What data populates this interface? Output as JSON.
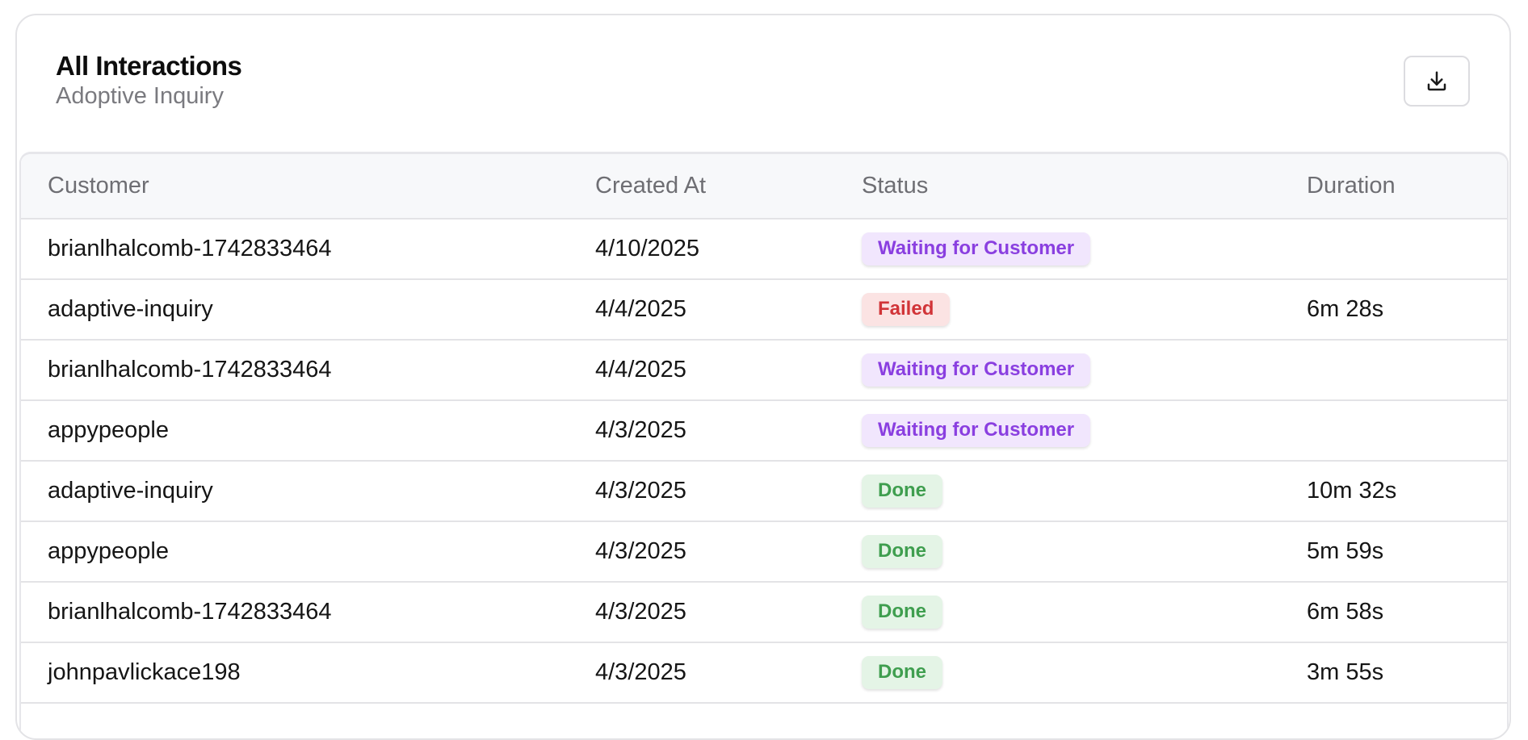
{
  "header": {
    "title": "All Interactions",
    "subtitle": "Adoptive Inquiry",
    "download_icon": "download-icon"
  },
  "table": {
    "columns": [
      "Customer",
      "Created At",
      "Status",
      "Duration"
    ],
    "rows": [
      {
        "customer": "brianlhalcomb-1742833464",
        "created_at": "4/10/2025",
        "status": "Waiting for Customer",
        "status_kind": "waiting",
        "duration": ""
      },
      {
        "customer": "adaptive-inquiry",
        "created_at": "4/4/2025",
        "status": "Failed",
        "status_kind": "failed",
        "duration": "6m 28s"
      },
      {
        "customer": "brianlhalcomb-1742833464",
        "created_at": "4/4/2025",
        "status": "Waiting for Customer",
        "status_kind": "waiting",
        "duration": ""
      },
      {
        "customer": "appypeople",
        "created_at": "4/3/2025",
        "status": "Waiting for Customer",
        "status_kind": "waiting",
        "duration": ""
      },
      {
        "customer": "adaptive-inquiry",
        "created_at": "4/3/2025",
        "status": "Done",
        "status_kind": "done",
        "duration": "10m 32s"
      },
      {
        "customer": "appypeople",
        "created_at": "4/3/2025",
        "status": "Done",
        "status_kind": "done",
        "duration": "5m 59s"
      },
      {
        "customer": "brianlhalcomb-1742833464",
        "created_at": "4/3/2025",
        "status": "Done",
        "status_kind": "done",
        "duration": "6m 58s"
      },
      {
        "customer": "johnpavlickace198",
        "created_at": "4/3/2025",
        "status": "Done",
        "status_kind": "done",
        "duration": "3m 55s"
      },
      {
        "customer": "",
        "created_at": "",
        "status": "",
        "status_kind": "",
        "duration": ""
      }
    ]
  },
  "colors": {
    "waiting_bg": "#f1e6fd",
    "waiting_fg": "#8a3fe0",
    "failed_bg": "#fbe3e3",
    "failed_fg": "#d13438",
    "done_bg": "#e4f4e6",
    "done_fg": "#3f9e4f"
  }
}
